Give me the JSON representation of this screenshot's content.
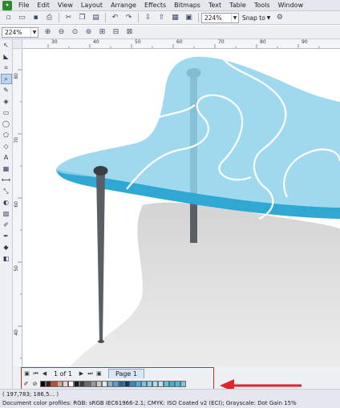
{
  "menu": {
    "items": [
      "File",
      "Edit",
      "View",
      "Layout",
      "Arrange",
      "Effects",
      "Bitmaps",
      "Text",
      "Table",
      "Tools",
      "Window"
    ]
  },
  "toolbar": {
    "zoom_value": "224%",
    "snap_label": "Snap to"
  },
  "propbar": {
    "zoom_value": "224%"
  },
  "ruler": {
    "h_labels": [
      "30",
      "40",
      "50",
      "60",
      "70",
      "80",
      "90"
    ],
    "v_labels": [
      "80",
      "70",
      "60",
      "50",
      "40"
    ]
  },
  "pagenav": {
    "page_info": "1 of 1",
    "page_tab": "Page 1"
  },
  "palette": {
    "colors": [
      "#000000",
      "#4a1a10",
      "#c84a2a",
      "#d8a090",
      "#f0d0c8",
      "#ffffff",
      "#1a1a1a",
      "#3a3a3a",
      "#6a6a6a",
      "#9a9a9a",
      "#c8c8c8",
      "#e0e8f0",
      "#7ab8d8",
      "#5aa0d0",
      "#1a6a9a",
      "#0a3a6a",
      "#2a8ad0",
      "#4ab0e0",
      "#6ac8e8",
      "#8ad0e8",
      "#a8dcf0",
      "#c0e4f4",
      "#5ac0e0",
      "#3ab0d8",
      "#4ab8e0",
      "#7ac4e0"
    ]
  },
  "status": {
    "coords": "( 197,783; 186,5... )",
    "profiles": "Document color profiles: RGB: sRGB IEC61966-2.1; CMYK: ISO Coated v2 (ECI); Grayscale: Dot Gain 15%"
  },
  "colors": {
    "highlight": "#e0262b",
    "glass": "#4cb8dc",
    "leg": "#5a5f66"
  }
}
